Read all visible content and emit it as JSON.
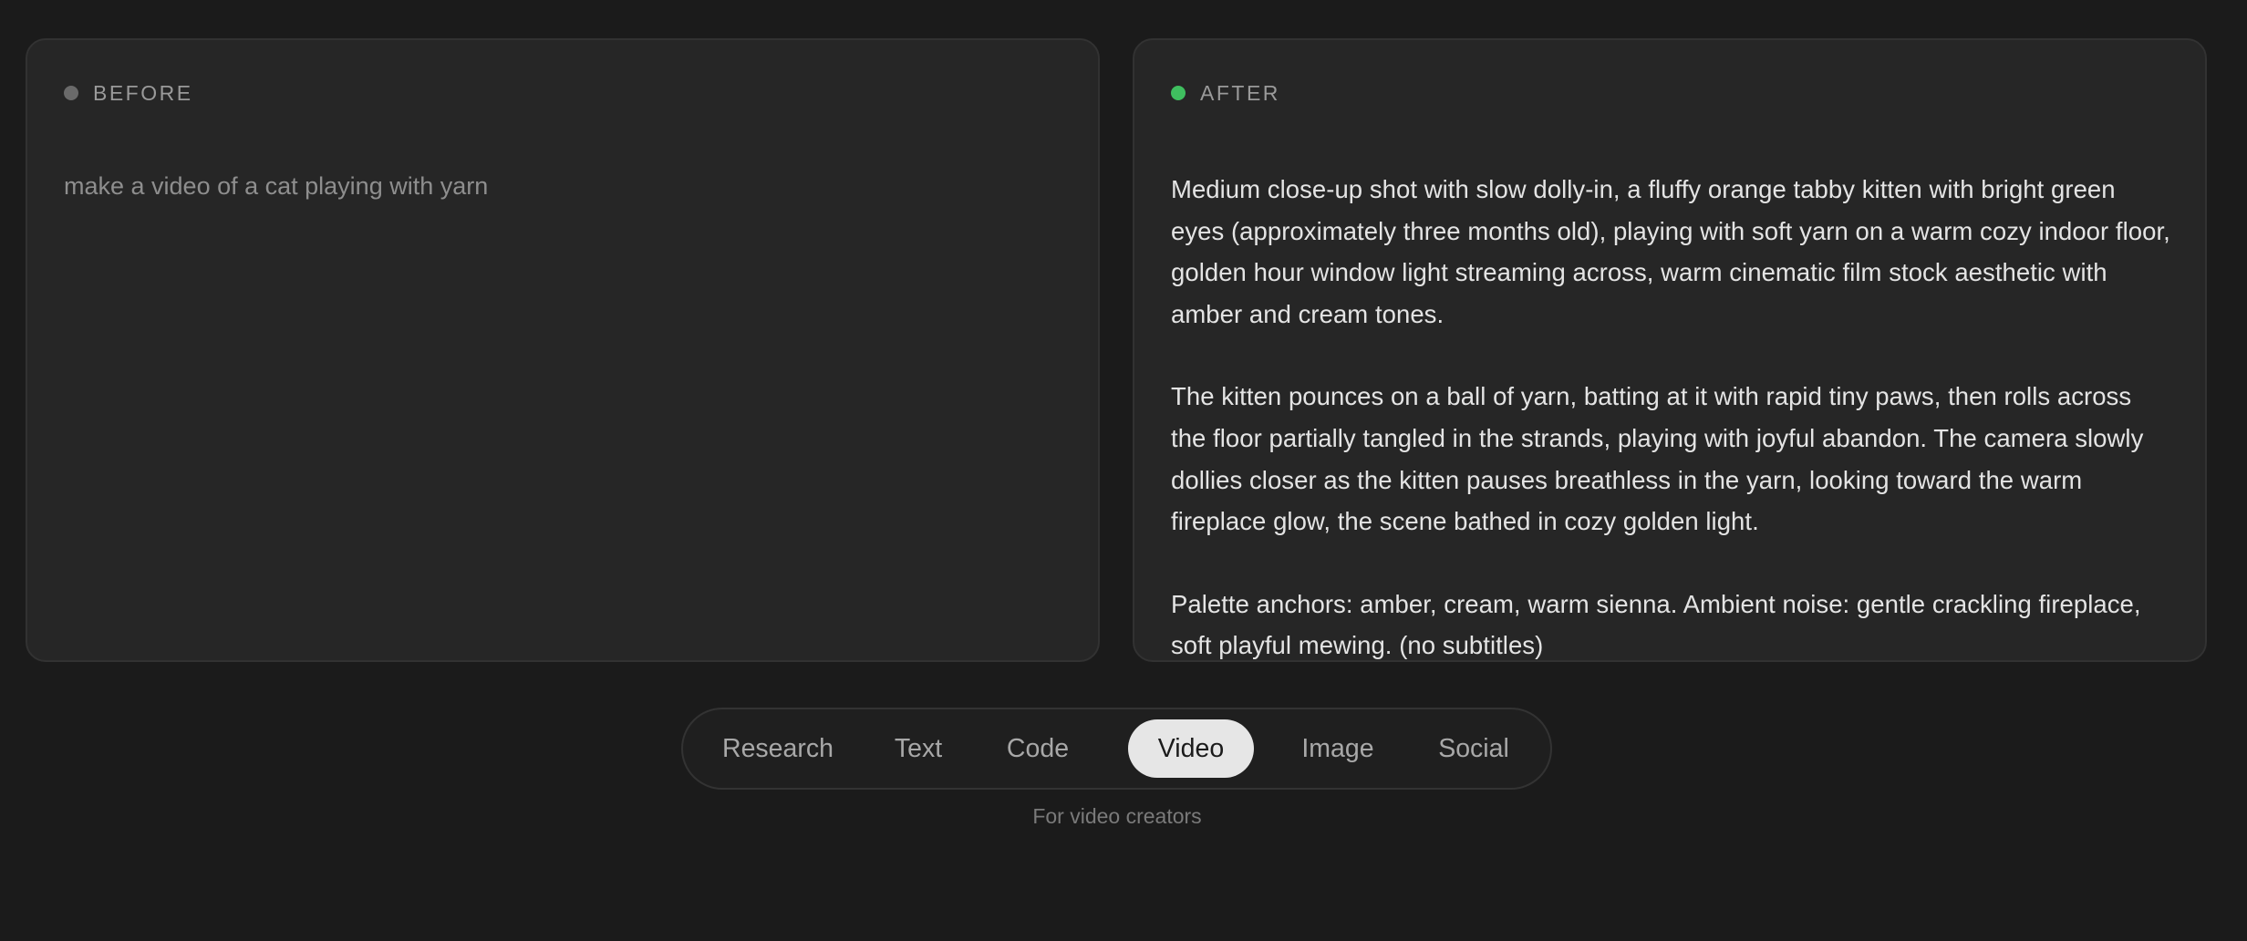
{
  "before": {
    "label": "BEFORE",
    "text": "make a video of a cat playing with yarn"
  },
  "after": {
    "label": "AFTER",
    "paragraphs": [
      "Medium close-up shot with slow dolly-in, a fluffy orange tabby kitten with bright green eyes (approximately three months old), playing with soft yarn on a warm cozy indoor floor, golden hour window light streaming across, warm cinematic film stock aesthetic with amber and cream tones.",
      "The kitten pounces on a ball of yarn, batting at it with rapid tiny paws, then rolls across the floor partially tangled in the strands, playing with joyful abandon. The camera slowly dollies closer as the kitten pauses breathless in the yarn, looking toward the warm fireplace glow, the scene bathed in cozy golden light.",
      "Palette anchors: amber, cream, warm sienna. Ambient noise: gentle crackling fireplace, soft playful mewing. (no subtitles)"
    ]
  },
  "tabs": [
    {
      "label": "Research",
      "active": false
    },
    {
      "label": "Text",
      "active": false
    },
    {
      "label": "Code",
      "active": false
    },
    {
      "label": "Video",
      "active": true
    },
    {
      "label": "Image",
      "active": false
    },
    {
      "label": "Social",
      "active": false
    }
  ],
  "caption": "For video creators",
  "colors": {
    "background": "#1b1b1b",
    "panel": "#262626",
    "after_indicator": "#3fbf5f",
    "before_indicator": "#6a6a6a",
    "active_tab": "#e6e6e6"
  }
}
